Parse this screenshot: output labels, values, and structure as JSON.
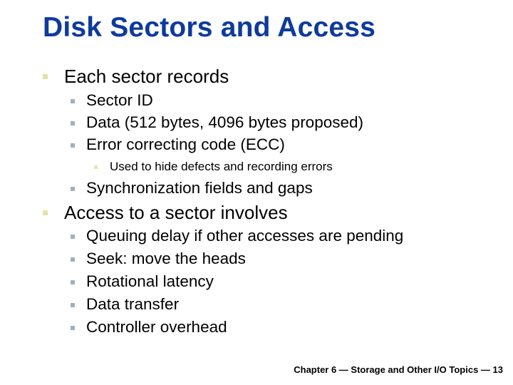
{
  "slide": {
    "title": "Disk Sectors and Access",
    "bullets": [
      {
        "text": "Each sector records",
        "children": [
          {
            "text": "Sector ID"
          },
          {
            "text": "Data (512 bytes, 4096 bytes proposed)"
          },
          {
            "text": "Error correcting code (ECC)",
            "children": [
              {
                "text": "Used to hide defects and recording errors"
              }
            ]
          },
          {
            "text": "Synchronization fields and gaps"
          }
        ]
      },
      {
        "text": "Access to a sector involves",
        "children": [
          {
            "text": "Queuing delay if other accesses are pending"
          },
          {
            "text": "Seek: move the heads"
          },
          {
            "text": "Rotational latency"
          },
          {
            "text": "Data transfer"
          },
          {
            "text": "Controller overhead"
          }
        ]
      }
    ],
    "footer": "Chapter 6 — Storage and Other I/O Topics — 13"
  },
  "colors": {
    "title": "#0e3a9c",
    "bullet_level1": "#e4e4a6",
    "bullet_level2": "#9bb1c2",
    "bullet_level3": "#e6e6ad"
  }
}
